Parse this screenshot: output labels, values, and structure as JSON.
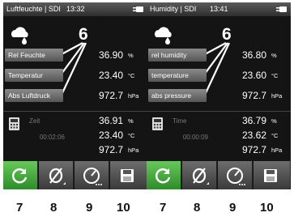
{
  "left": {
    "title": "Luftfeuchte | SDI",
    "time": "13:32",
    "callout": "6",
    "rows": [
      {
        "label": "Rel Feuchte",
        "value": "36.90",
        "unit": "%"
      },
      {
        "label": "Temperatur",
        "value": "23.40",
        "unit": "°C"
      },
      {
        "label": "Abs Luftdruck",
        "value": "972.7",
        "unit": "hPa"
      }
    ],
    "timer_label": "Zeit",
    "timer_value": "00:02:06",
    "stats": [
      {
        "value": "36.91",
        "unit": "%"
      },
      {
        "value": "23.40",
        "unit": "°C"
      },
      {
        "value": "972.7",
        "unit": "hPa"
      }
    ]
  },
  "right": {
    "title": "Humidity | SDI",
    "time": "13:41",
    "callout": "6",
    "rows": [
      {
        "label": "rel humidity",
        "value": "36.80",
        "unit": "%"
      },
      {
        "label": "temperature",
        "value": "23.60",
        "unit": "°C"
      },
      {
        "label": "abs pressure",
        "value": "972.7",
        "unit": "hPa"
      }
    ],
    "timer_label": "Time",
    "timer_value": "00:00:09",
    "stats": [
      {
        "value": "36.79",
        "unit": "%"
      },
      {
        "value": "23.62",
        "unit": "°C"
      },
      {
        "value": "972.7",
        "unit": "hPa"
      }
    ]
  },
  "captions": [
    "7",
    "8",
    "9",
    "10",
    "7",
    "8",
    "9",
    "10"
  ],
  "colors": {
    "active_button": "#3aa53a",
    "screen_bg": "#141414"
  },
  "icons": {
    "toolbar": [
      "refresh-icon",
      "zero-icon",
      "gauge-icon",
      "save-icon"
    ]
  }
}
